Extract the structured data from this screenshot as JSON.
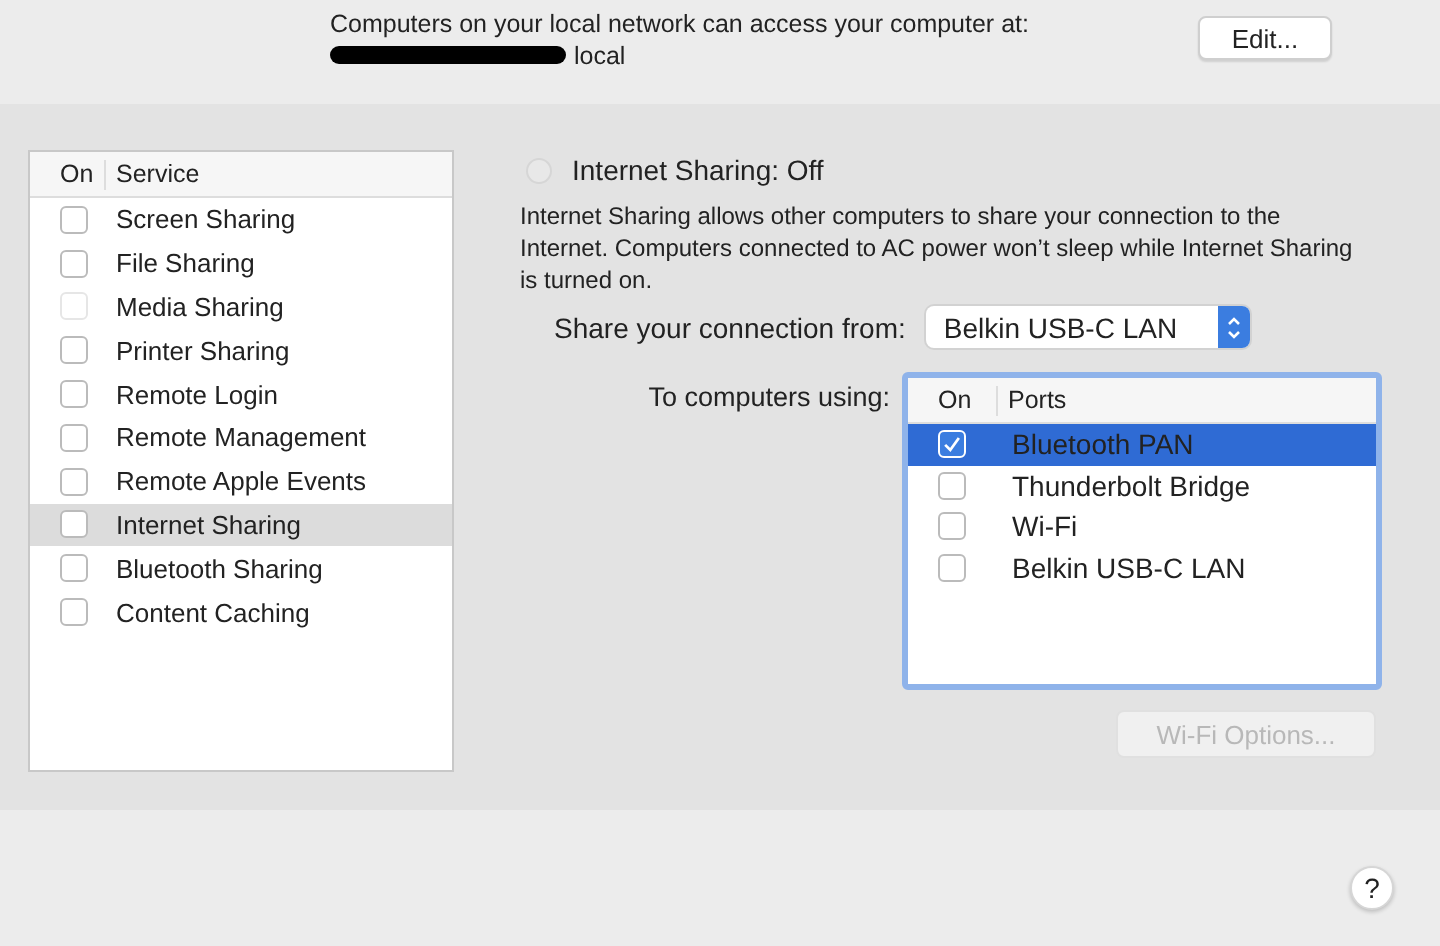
{
  "header": {
    "message": "Computers on your local network can access your computer at:",
    "address": "local",
    "address_redacted": true,
    "edit_button": "Edit..."
  },
  "services": {
    "columns": [
      "On",
      "Service"
    ],
    "rows": [
      {
        "name": "Screen Sharing",
        "checked": false,
        "disabled": false,
        "selected": false
      },
      {
        "name": "File Sharing",
        "checked": false,
        "disabled": false,
        "selected": false
      },
      {
        "name": "Media Sharing",
        "checked": false,
        "disabled": true,
        "selected": false
      },
      {
        "name": "Printer Sharing",
        "checked": false,
        "disabled": false,
        "selected": false
      },
      {
        "name": "Remote Login",
        "checked": false,
        "disabled": false,
        "selected": false
      },
      {
        "name": "Remote Management",
        "checked": false,
        "disabled": false,
        "selected": false
      },
      {
        "name": "Remote Apple Events",
        "checked": false,
        "disabled": false,
        "selected": false
      },
      {
        "name": "Internet Sharing",
        "checked": false,
        "disabled": false,
        "selected": true
      },
      {
        "name": "Bluetooth Sharing",
        "checked": false,
        "disabled": false,
        "selected": false
      },
      {
        "name": "Content Caching",
        "checked": false,
        "disabled": false,
        "selected": false
      }
    ]
  },
  "detail": {
    "status": {
      "label": "Internet Sharing: Off",
      "on": false
    },
    "description": "Internet Sharing allows other computers to share your connection to the Internet. Computers connected to AC power won’t sleep while Internet Sharing is turned on.",
    "share_from": {
      "label": "Share your connection from:",
      "value": "Belkin USB-C LAN"
    },
    "to_computers": {
      "label": "To computers using:",
      "columns": [
        "On",
        "Ports"
      ],
      "rows": [
        {
          "name": "Bluetooth PAN",
          "checked": true,
          "selected": true
        },
        {
          "name": "Thunderbolt Bridge",
          "checked": false,
          "selected": false
        },
        {
          "name": "Wi-Fi",
          "checked": false,
          "selected": false
        },
        {
          "name": "Belkin USB-C LAN",
          "checked": false,
          "selected": false
        }
      ]
    },
    "wifi_options_button": {
      "label": "Wi-Fi Options...",
      "disabled": true
    }
  },
  "help_button": "?"
}
